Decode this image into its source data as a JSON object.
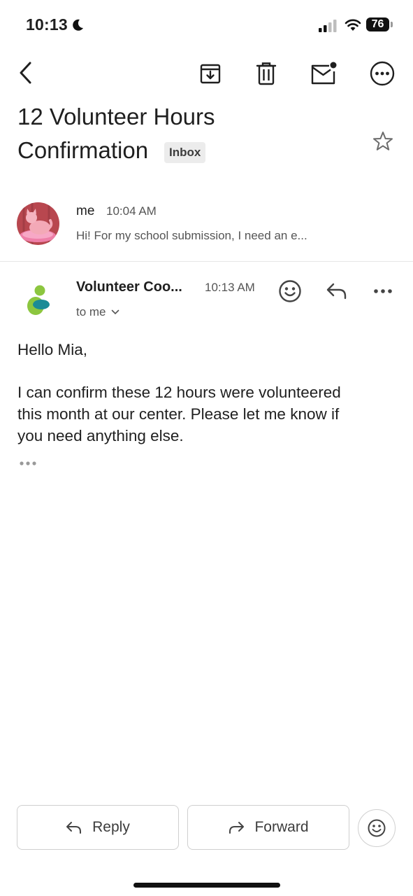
{
  "status_bar": {
    "time": "10:13",
    "battery": "76"
  },
  "toolbar": {
    "back_icon": "chevron-left-icon",
    "archive_icon": "archive-icon",
    "delete_icon": "trash-icon",
    "mark_unread_icon": "mark-unread-icon",
    "more_icon": "more-horizontal-circle-icon"
  },
  "subject": {
    "line1": "12 Volunteer Hours",
    "line2": "Confirmation",
    "label": "Inbox",
    "star_icon": "star-outline-icon"
  },
  "messages": [
    {
      "sender": "me",
      "time": "10:04 AM",
      "snippet": "Hi! For my school submission, I need an e..."
    },
    {
      "sender": "Volunteer Coo...",
      "time": "10:13 AM",
      "recipient": "to me",
      "greeting": "Hello Mia,",
      "body_lines": [
        "I can confirm these 12 hours were volunteered",
        "this month at our center. Please let me know if",
        "you need anything else."
      ]
    }
  ],
  "actions": {
    "reply_label": "Reply",
    "forward_label": "Forward"
  },
  "colors": {
    "logo_green": "#8cc63f",
    "logo_teal": "#1b8b96",
    "avatar_bg": "#b8474f"
  }
}
